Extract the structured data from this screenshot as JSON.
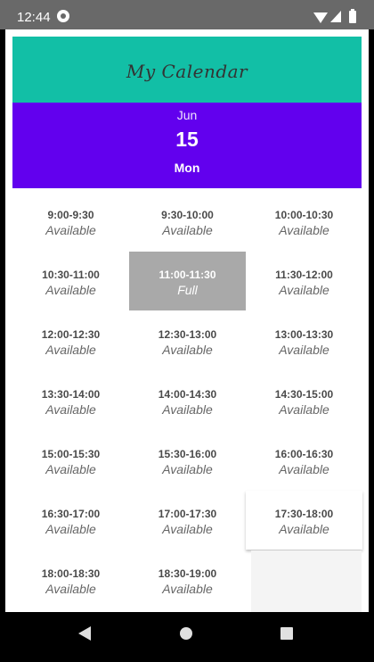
{
  "status_bar": {
    "time": "12:44",
    "icons": [
      "settings-gear-icon",
      "wifi-icon",
      "signal-icon",
      "battery-icon"
    ]
  },
  "header": {
    "title": "My Calendar",
    "color": "#12bfa6"
  },
  "date": {
    "month": "Jun",
    "day": "15",
    "weekday": "Mon",
    "color": "#6200ee"
  },
  "slots": [
    {
      "time": "9:00-9:30",
      "status": "Available"
    },
    {
      "time": "9:30-10:00",
      "status": "Available"
    },
    {
      "time": "10:00-10:30",
      "status": "Available"
    },
    {
      "time": "10:30-11:00",
      "status": "Available"
    },
    {
      "time": "11:00-11:30",
      "status": "Full"
    },
    {
      "time": "11:30-12:00",
      "status": "Available"
    },
    {
      "time": "12:00-12:30",
      "status": "Available"
    },
    {
      "time": "12:30-13:00",
      "status": "Available"
    },
    {
      "time": "13:00-13:30",
      "status": "Available"
    },
    {
      "time": "13:30-14:00",
      "status": "Available"
    },
    {
      "time": "14:00-14:30",
      "status": "Available"
    },
    {
      "time": "14:30-15:00",
      "status": "Available"
    },
    {
      "time": "15:00-15:30",
      "status": "Available"
    },
    {
      "time": "15:30-16:00",
      "status": "Available"
    },
    {
      "time": "16:00-16:30",
      "status": "Available"
    },
    {
      "time": "16:30-17:00",
      "status": "Available"
    },
    {
      "time": "17:00-17:30",
      "status": "Available"
    },
    {
      "time": "17:30-18:00",
      "status": "Available"
    },
    {
      "time": "18:00-18:30",
      "status": "Available"
    },
    {
      "time": "18:30-19:00",
      "status": "Available"
    }
  ],
  "nav_bar": {
    "buttons": [
      "back-icon",
      "home-icon",
      "recent-apps-icon"
    ]
  }
}
